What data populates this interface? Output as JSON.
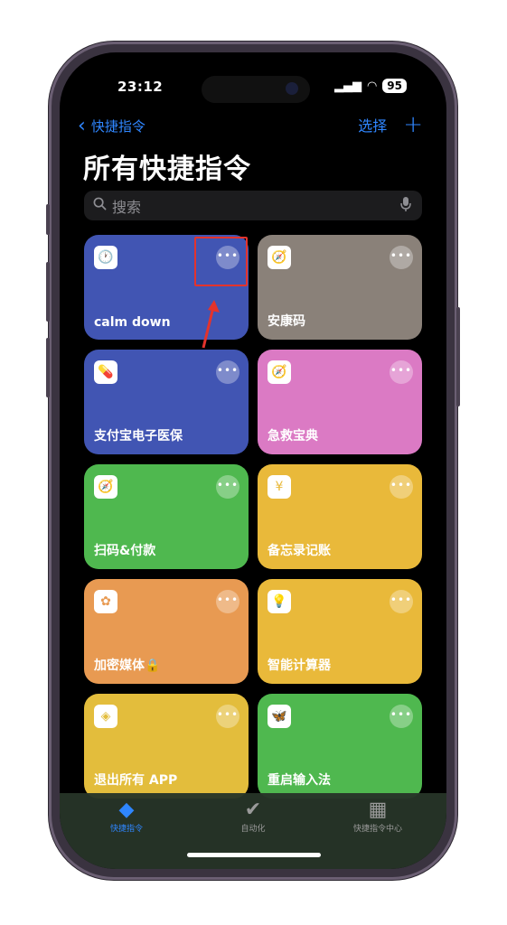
{
  "status_bar": {
    "time": "23:12",
    "battery": "95",
    "signal_icon": "cellular-signal-icon",
    "wifi_icon": "wifi-icon"
  },
  "nav": {
    "back_label": "快捷指令",
    "select_label": "选择",
    "add_icon": "+",
    "back_icon": "‹"
  },
  "page_title": "所有快捷指令",
  "search": {
    "placeholder": "搜索"
  },
  "shortcuts": [
    {
      "label": "calm down",
      "color": "#4155b3",
      "icon": "clock-icon",
      "glyph": "🕐"
    },
    {
      "label": "安康码",
      "color": "#8a8179",
      "icon": "safari-icon",
      "glyph": "🧭"
    },
    {
      "label": "支付宝电子医保",
      "color": "#4155b3",
      "icon": "medicine-bottle-icon",
      "glyph": "💊"
    },
    {
      "label": "急救宝典",
      "color": "#db7ac4",
      "icon": "safari-icon",
      "glyph": "🧭"
    },
    {
      "label": "扫码&付款",
      "color": "#4fb84f",
      "icon": "safari-icon",
      "glyph": "🧭"
    },
    {
      "label": "备忘录记账",
      "color": "#e9b93a",
      "icon": "yen-icon",
      "glyph": "¥"
    },
    {
      "label": "加密媒体🔒",
      "color": "#e89a52",
      "icon": "photos-icon",
      "glyph": "✿"
    },
    {
      "label": "智能计算器",
      "color": "#e9b93a",
      "icon": "lightbulb-icon",
      "glyph": "💡"
    },
    {
      "label": "退出所有 APP",
      "color": "#e3bd3c",
      "icon": "layers-icon",
      "glyph": "◈"
    },
    {
      "label": "重启输入法",
      "color": "#4fb84f",
      "icon": "butterfly-app-icon",
      "glyph": "🦋"
    }
  ],
  "more_label": "•••",
  "tab_bar": [
    {
      "label": "快捷指令",
      "icon": "shortcuts-stack-icon",
      "glyph": "◆",
      "active": true
    },
    {
      "label": "自动化",
      "icon": "automation-check-icon",
      "glyph": "✔",
      "active": false
    },
    {
      "label": "快捷指令中心",
      "icon": "gallery-icon",
      "glyph": "▦",
      "active": false
    }
  ]
}
